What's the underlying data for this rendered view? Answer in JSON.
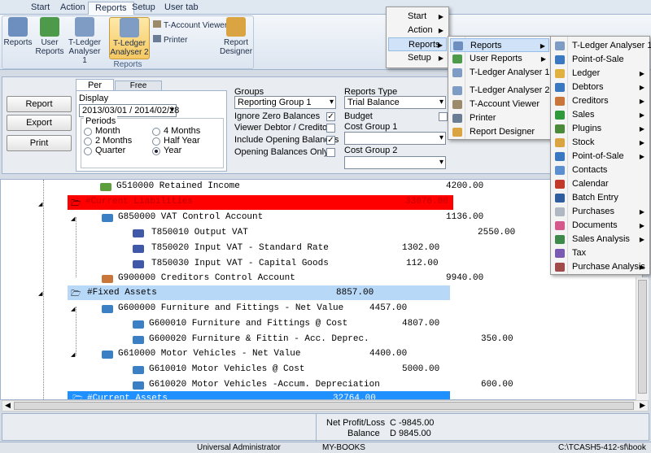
{
  "ribbon": {
    "tabs": [
      "Start",
      "Action",
      "Reports",
      "Setup",
      "User tab"
    ],
    "active_tab": "Reports",
    "buttons": {
      "reports": "Reports",
      "user_reports": "User Reports",
      "tledger1": "T-Ledger Analyser 1",
      "tledger2": "T-Ledger Analyser 2",
      "taccount": "T-Account Viewer",
      "printer": "Printer",
      "designer": "Report Designer"
    },
    "group_label": "Reports"
  },
  "filters": {
    "report_button": "Report",
    "export_button": "Export",
    "print_button": "Print",
    "tab_per_period": "Per Period",
    "tab_free_selection": "Free Selection",
    "display_label": "Display",
    "display_value": "2013/03/01 / 2014/02/28",
    "periods_label": "Periods",
    "periods": [
      "Month",
      "4 Months",
      "2 Months",
      "Half Year",
      "Quarter",
      "Year"
    ],
    "selected_period": "Year",
    "groups_label": "Groups",
    "groups_value": "Reporting Group 1",
    "ignore_zero": "Ignore Zero Balances",
    "viewer_debtor": "Viewer Debtor / Creditor",
    "include_opening": "Include Opening Balances",
    "opening_only": "Opening Balances Only",
    "reports_type_label": "Reports Type",
    "reports_type_value": "Trial Balance",
    "budget_label": "Budget",
    "cost_group_1": "Cost Group 1",
    "cost_group_2": "Cost Group 2"
  },
  "report_rows": [
    {
      "text": "G510000 Retained Income",
      "amount": "4200.00"
    },
    {
      "text": "#Current Liabilities",
      "amount": "33076.00"
    },
    {
      "text": "G850000 VAT Control Account",
      "amount": "1136.00"
    },
    {
      "text": "T850010 Output VAT",
      "amount": "2550.00"
    },
    {
      "text": "T850020 Input VAT - Standard Rate",
      "amount": "1302.00"
    },
    {
      "text": "T850030 Input VAT - Capital Goods",
      "amount": "112.00"
    },
    {
      "text": "G900000 Creditors Control Account",
      "amount": "9940.00"
    },
    {
      "text": "#Fixed Assets",
      "amount": "8857.00"
    },
    {
      "text": "G600000 Furniture and Fittings - Net Value",
      "amount": "4457.00"
    },
    {
      "text": "G600010 Furniture and Fittings @ Cost",
      "amount": "4807.00"
    },
    {
      "text": "G600020 Furniture & Fittin - Acc. Deprec.",
      "amount": "350.00"
    },
    {
      "text": "G610000 Motor Vehicles - Net Value",
      "amount": "4400.00"
    },
    {
      "text": "G610010 Motor Vehicles @ Cost",
      "amount": "5000.00"
    },
    {
      "text": "G610020 Motor Vehicles -Accum. Depreciation",
      "amount": "600.00"
    },
    {
      "text": "#Current Assets",
      "amount": "32764.00"
    }
  ],
  "summary": {
    "net_label": "Net Profit/Loss",
    "net_value": "C -9845.00",
    "balance_label": "Balance",
    "balance_value": "D 9845.00"
  },
  "status": {
    "user": "Universal Administrator",
    "company": "MY-BOOKS",
    "path": "C:\\TCASH5-412-sf\\book"
  },
  "menu1": [
    "Start",
    "Action",
    "Reports",
    "Setup"
  ],
  "menu2": [
    "Reports",
    "User Reports",
    "T-Ledger Analyser 1",
    "T-Ledger Analyser 2",
    "T-Account Viewer",
    "Printer",
    "Report Designer"
  ],
  "menu3": [
    "T-Ledger Analyser 1",
    "Point-of-Sale",
    "Ledger",
    "Debtors",
    "Creditors",
    "Sales",
    "Plugins",
    "Stock",
    "Point-of-Sale",
    "Contacts",
    "Calendar",
    "Batch Entry",
    "Purchases",
    "Documents",
    "Sales Analysis",
    "Tax",
    "Purchase Analysis"
  ],
  "colors": {
    "current_liabilities": "#ff0000",
    "fixed_assets": "#b8d8f8",
    "current_assets": "#1e90ff"
  }
}
